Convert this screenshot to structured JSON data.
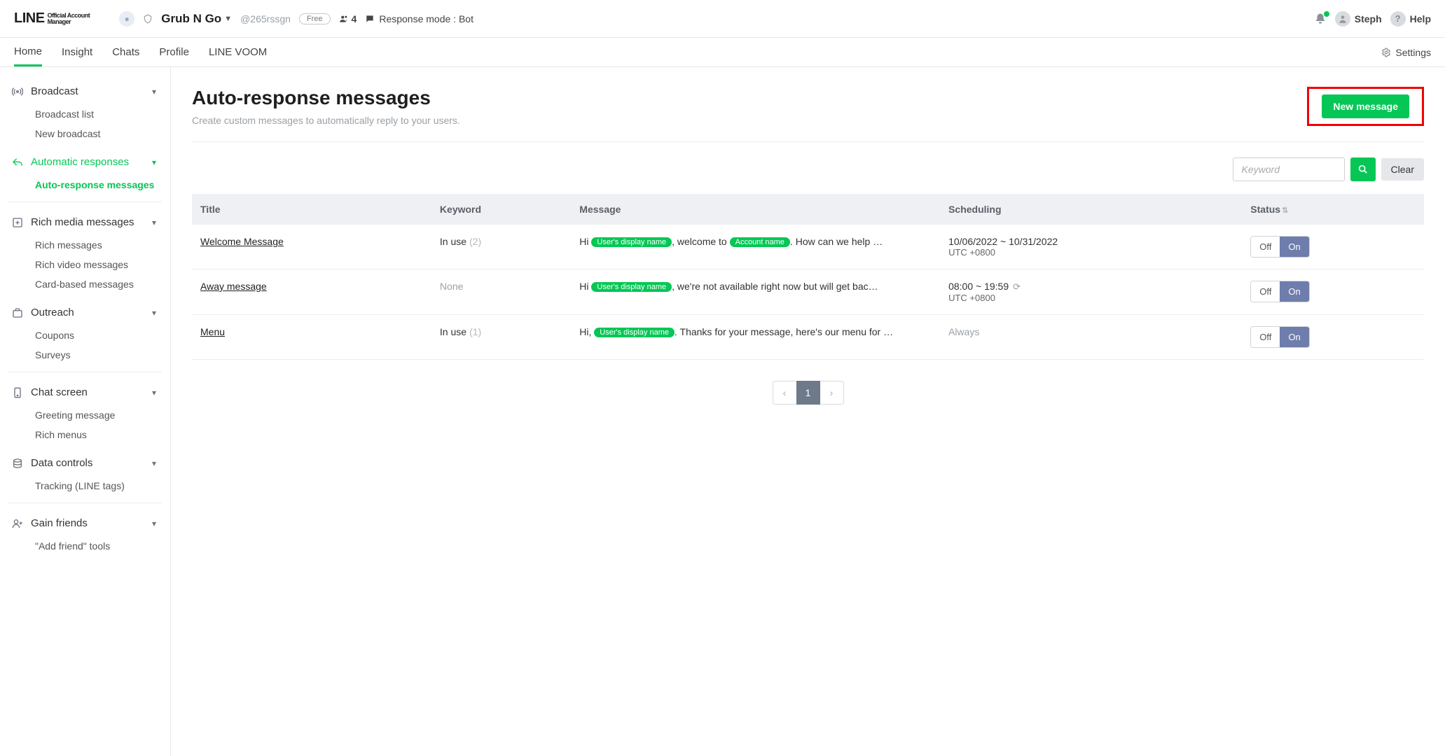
{
  "header": {
    "logo_main": "LINE",
    "logo_sub1": "Official Account",
    "logo_sub2": "Manager",
    "account_name": "Grub N Go",
    "account_handle": "@265rssgn",
    "plan_badge": "Free",
    "friends_count": "4",
    "response_mode": "Response mode : Bot",
    "user_name": "Steph",
    "help_label": "Help"
  },
  "nav": {
    "items": [
      "Home",
      "Insight",
      "Chats",
      "Profile",
      "LINE VOOM"
    ],
    "active_index": 0,
    "settings_label": "Settings"
  },
  "sidebar": {
    "broadcast": {
      "label": "Broadcast",
      "items": [
        "Broadcast list",
        "New broadcast"
      ]
    },
    "auto": {
      "label": "Automatic responses",
      "items": [
        "Auto-response messages"
      ],
      "active": true,
      "active_sub": 0
    },
    "rich": {
      "label": "Rich media messages",
      "items": [
        "Rich messages",
        "Rich video messages",
        "Card-based messages"
      ]
    },
    "outreach": {
      "label": "Outreach",
      "items": [
        "Coupons",
        "Surveys"
      ]
    },
    "chat": {
      "label": "Chat screen",
      "items": [
        "Greeting message",
        "Rich menus"
      ]
    },
    "data": {
      "label": "Data controls",
      "items": [
        "Tracking (LINE tags)"
      ]
    },
    "gain": {
      "label": "Gain friends",
      "items": [
        "\"Add friend\" tools"
      ]
    }
  },
  "page": {
    "title": "Auto-response messages",
    "subtitle": "Create custom messages to automatically reply to your users.",
    "new_button": "New message",
    "search_placeholder": "Keyword",
    "clear_label": "Clear"
  },
  "table": {
    "cols": [
      "Title",
      "Keyword",
      "Message",
      "Scheduling",
      "Status"
    ],
    "rows": [
      {
        "title": "Welcome Message",
        "keyword_status": "In use",
        "keyword_count": "(2)",
        "msg_pre": "Hi ",
        "pill1": "User's display name",
        "msg_mid": ", welcome to ",
        "pill2": "Account name",
        "msg_post": ". How can we help …",
        "sched_line1": "10/06/2022 ~ 10/31/2022",
        "sched_line2": "UTC +0800",
        "repeat": false,
        "off": "Off",
        "on": "On",
        "status": "On"
      },
      {
        "title": "Away message",
        "keyword_status": "None",
        "keyword_count": "",
        "msg_pre": "Hi ",
        "pill1": "User's display name",
        "msg_mid": ", we're not available right now but will get bac…",
        "pill2": "",
        "msg_post": "",
        "sched_line1": "08:00 ~ 19:59",
        "sched_line2": "UTC +0800",
        "repeat": true,
        "off": "Off",
        "on": "On",
        "status": "On"
      },
      {
        "title": "Menu",
        "keyword_status": "In use",
        "keyword_count": "(1)",
        "msg_pre": "Hi, ",
        "pill1": "User's display name",
        "msg_mid": ". Thanks for your message, here's our menu for …",
        "pill2": "",
        "msg_post": "",
        "sched_line1": "Always",
        "sched_line2": "",
        "repeat": false,
        "off": "Off",
        "on": "On",
        "status": "On"
      }
    ]
  },
  "pagination": {
    "current": "1"
  }
}
